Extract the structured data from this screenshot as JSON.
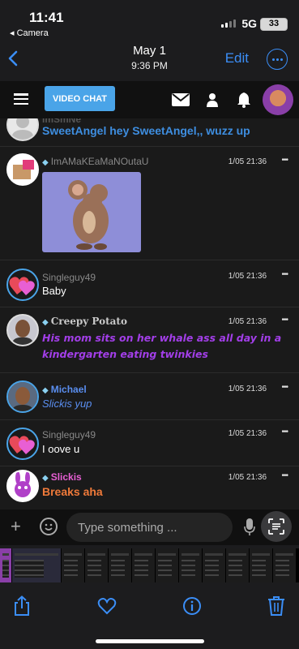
{
  "status_bar": {
    "time": "11:41",
    "back_app": "◂ Camera",
    "network": "5G",
    "battery": "33"
  },
  "photos_header": {
    "date": "May 1",
    "time": "9:36 PM",
    "edit_label": "Edit"
  },
  "app_nav": {
    "video_chat_label": "VIDEO CHAT"
  },
  "messages": [
    {
      "name": "",
      "text": "SweetAngel hey SweetAngel,, wuzz up",
      "time": ""
    },
    {
      "name": "ImAMaKEaMaNOutaU",
      "text": "",
      "time": "1/05 21:36",
      "has_image": true
    },
    {
      "name": "Singleguy49",
      "text": "Baby",
      "time": "1/05 21:36"
    },
    {
      "name": "Creepy Potato",
      "text": "His mom sits on her whale ass all day in a kindergarten eating twinkies",
      "time": "1/05 21:36"
    },
    {
      "name": "Michael",
      "text": "Slickis yup",
      "time": "1/05 21:36"
    },
    {
      "name": "Singleguy49",
      "text": "I oove u",
      "time": "1/05 21:36"
    },
    {
      "name": "Slickis",
      "text": "Breaks aha",
      "time": "1/05 21:36"
    }
  ],
  "more_glyph": "•••",
  "composer": {
    "placeholder": "Type something ..."
  },
  "colors": {
    "accent_blue": "#4aa4e8",
    "ios_blue": "#3b8ef7",
    "purple_text": "#a23ee8",
    "orange_text": "#f07a3a",
    "pink_name": "#e85fd4"
  },
  "icons": [
    "chevron-left-icon",
    "more-icon",
    "hamburger-icon",
    "mail-icon",
    "user-icon",
    "bell-icon",
    "plus-icon",
    "emoji-icon",
    "mic-icon",
    "scan-text-icon",
    "share-icon",
    "heart-icon",
    "info-icon",
    "trash-icon"
  ]
}
